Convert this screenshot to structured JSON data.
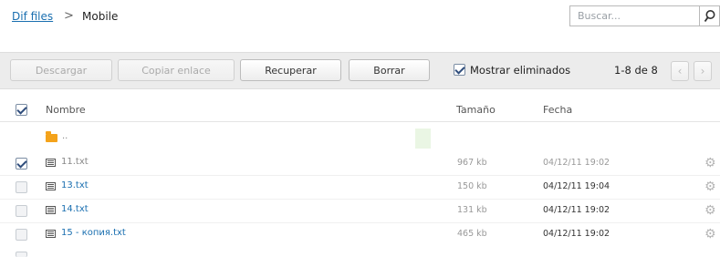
{
  "breadcrumb": {
    "root": "Dif files",
    "separator": ">",
    "current": "Mobile"
  },
  "search": {
    "placeholder": "Buscar...",
    "button_icon": "search-icon"
  },
  "toolbar": {
    "download_label": "Descargar",
    "copy_link_label": "Copiar enlace",
    "recover_label": "Recuperar",
    "delete_label": "Borrar",
    "show_deleted_label": "Mostrar eliminados",
    "show_deleted_checked": true,
    "pager_text": "1-8 de 8",
    "prev_icon": "chevron-left-icon",
    "next_icon": "chevron-right-icon"
  },
  "table": {
    "columns": {
      "name": "Nombre",
      "size": "Tamaño",
      "date": "Fecha"
    },
    "parent_row": {
      "label": "..",
      "icon": "folder-icon"
    },
    "rows": [
      {
        "name": "11.txt",
        "size": "967 kb",
        "date": "04/12/11 19:02",
        "checked": true,
        "deleted": true,
        "icon": "text-file-icon",
        "action_icon": "gear-icon"
      },
      {
        "name": "13.txt",
        "size": "150 kb",
        "date": "04/12/11 19:04",
        "checked": false,
        "deleted": false,
        "icon": "text-file-icon",
        "action_icon": "gear-icon"
      },
      {
        "name": "14.txt",
        "size": "131 kb",
        "date": "04/12/11 19:02",
        "checked": false,
        "deleted": false,
        "icon": "text-file-icon",
        "action_icon": "gear-icon"
      },
      {
        "name": "15 - копия.txt",
        "size": "465 kb",
        "date": "04/12/11 19:02",
        "checked": false,
        "deleted": false,
        "icon": "text-file-icon",
        "action_icon": "gear-icon"
      }
    ]
  },
  "colors": {
    "link": "#1a6fb0",
    "toolbar_bg": "#ececec",
    "folder": "#f4a31b"
  }
}
